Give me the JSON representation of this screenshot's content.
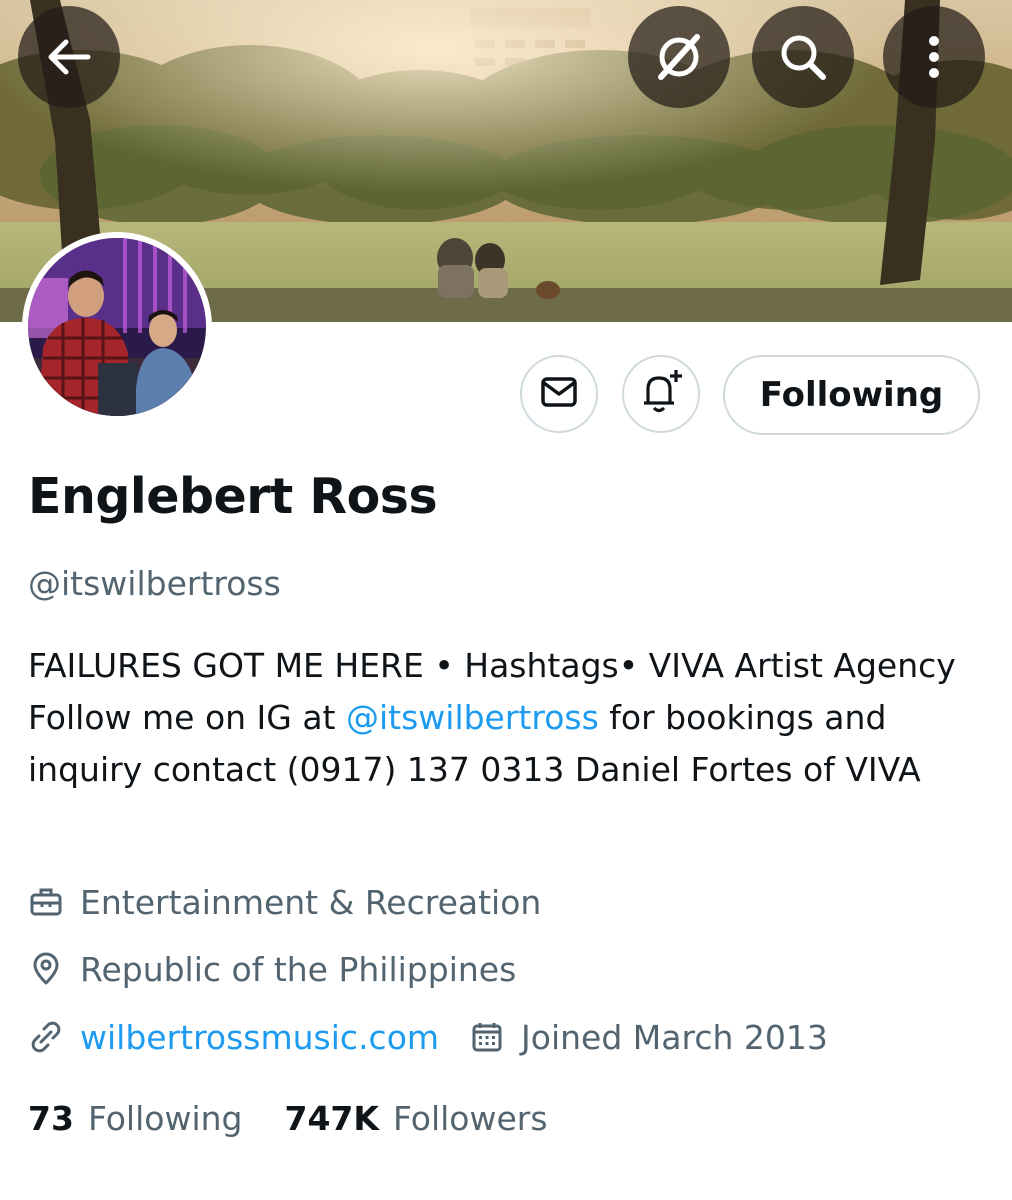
{
  "header": {
    "back_icon": "arrow-left-icon",
    "actions": [
      "grok-icon",
      "search-icon",
      "more-vertical-icon"
    ]
  },
  "profile": {
    "name": "Englebert Ross",
    "handle": "@itswilbertross",
    "follow_label": "Following",
    "message_icon": "envelope-icon",
    "notify_icon": "bell-plus-icon",
    "bio": {
      "part1": "FAILURES GOT ME HERE • Hashtags• VIVA Artist Agency Follow me on IG at ",
      "mention": "@itswilbertross",
      "part2": " for bookings and inquiry contact (0917) 137 0313 Daniel Fortes of VIVA"
    },
    "category": "Entertainment & Recreation",
    "location": "Republic of the Philippines",
    "website": "wilbertrossmusic.com",
    "joined": "Joined March 2013"
  },
  "stats": {
    "following_count": "73",
    "following_label": "Following",
    "followers_count": "747K",
    "followers_label": "Followers"
  },
  "colors": {
    "link": "#1d9bf0",
    "secondary_text": "#536471",
    "border": "#cfd9de"
  }
}
